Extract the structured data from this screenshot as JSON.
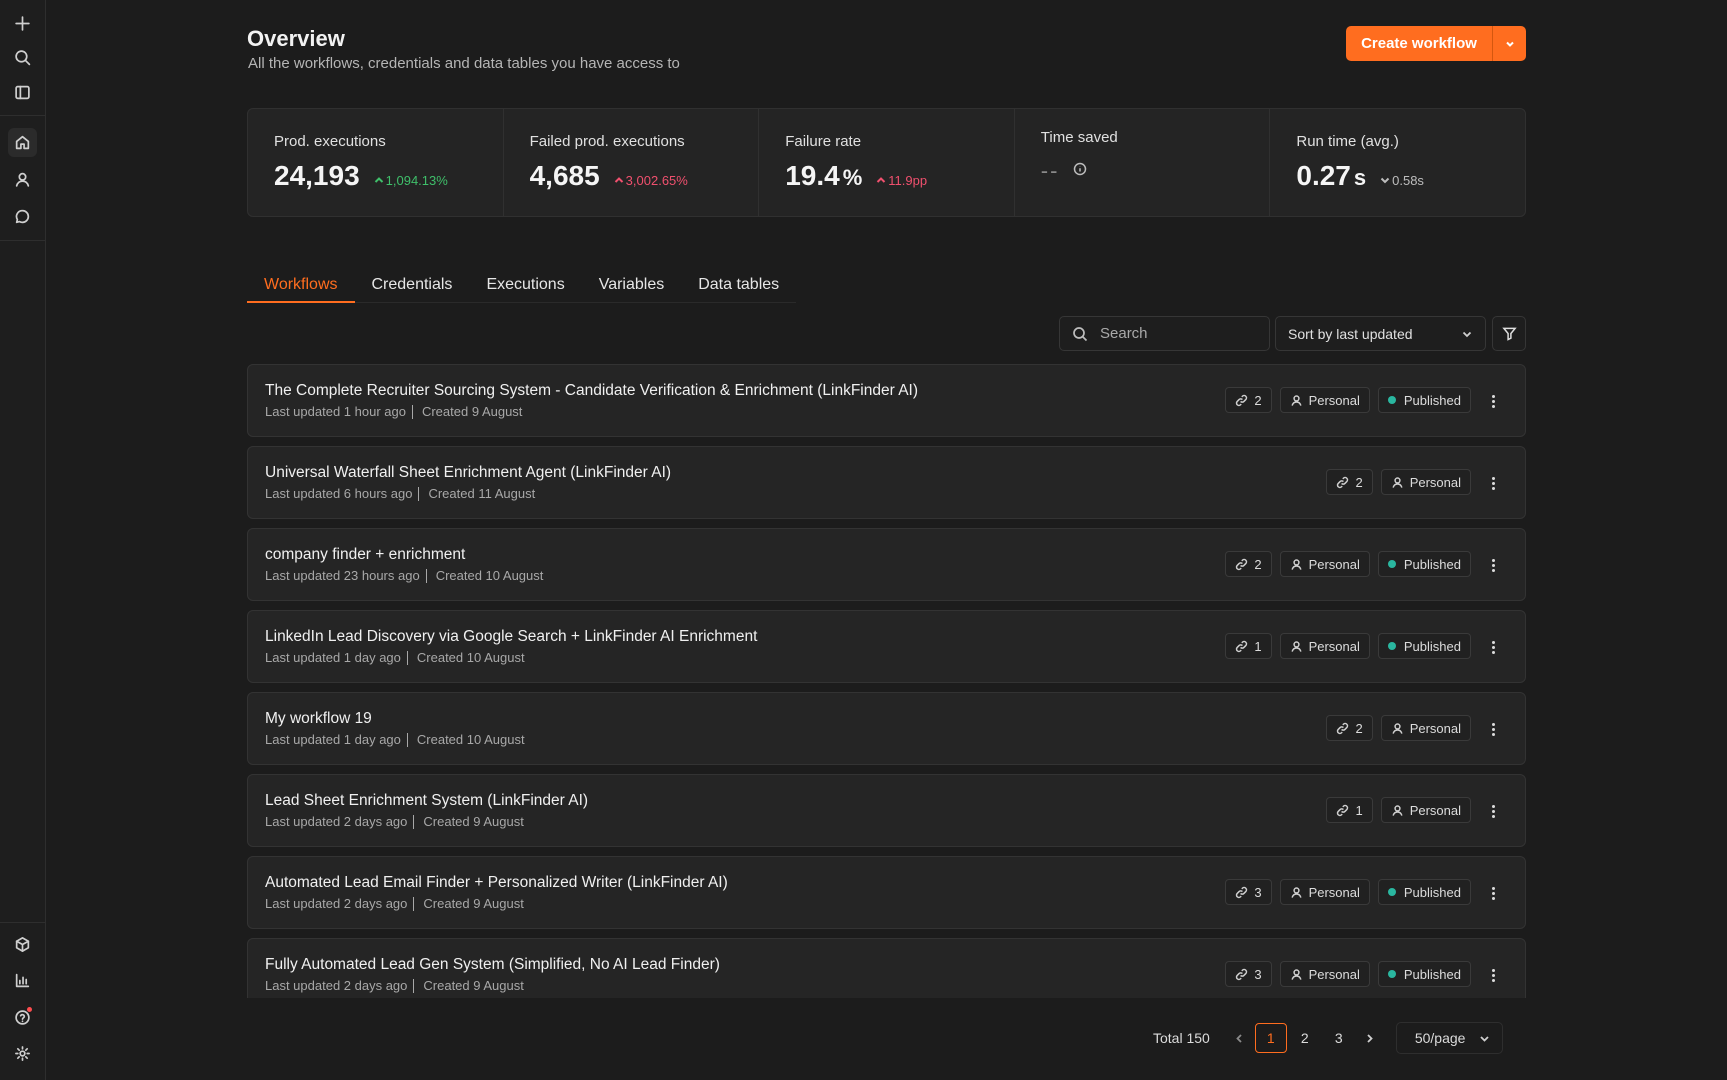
{
  "header": {
    "title": "Overview",
    "subtitle": "All the workflows, credentials and data tables you have access to",
    "create_label": "Create workflow"
  },
  "stats": [
    {
      "label": "Prod. executions",
      "value": "24,193",
      "unit": "",
      "delta": "1,094.13%",
      "trend": "up-good"
    },
    {
      "label": "Failed prod. executions",
      "value": "4,685",
      "unit": "",
      "delta": "3,002.65%",
      "trend": "up-bad"
    },
    {
      "label": "Failure rate",
      "value": "19.4",
      "unit": "%",
      "delta": "11.9pp",
      "trend": "up-bad"
    },
    {
      "label": "Time saved",
      "value": "--",
      "unit": "",
      "delta": "",
      "trend": "none"
    },
    {
      "label": "Run time (avg.)",
      "value": "0.27",
      "unit": "s",
      "delta": "0.58s",
      "trend": "down-neutral"
    }
  ],
  "tabs": [
    "Workflows",
    "Credentials",
    "Executions",
    "Variables",
    "Data tables"
  ],
  "toolbar": {
    "search_placeholder": "Search",
    "sort_label": "Sort by last updated"
  },
  "workflows": [
    {
      "title": "The Complete Recruiter Sourcing System - Candidate Verification & Enrichment (LinkFinder AI)",
      "updated": "Last updated 1 hour ago",
      "created": "Created 9 August",
      "links": "2",
      "owner": "Personal",
      "status": "Published"
    },
    {
      "title": "Universal Waterfall Sheet Enrichment Agent (LinkFinder AI)",
      "updated": "Last updated 6 hours ago",
      "created": "Created 11 August",
      "links": "2",
      "owner": "Personal",
      "status": ""
    },
    {
      "title": "company finder + enrichment",
      "updated": "Last updated 23 hours ago",
      "created": "Created 10 August",
      "links": "2",
      "owner": "Personal",
      "status": "Published"
    },
    {
      "title": "LinkedIn Lead Discovery via Google Search + LinkFinder AI Enrichment",
      "updated": "Last updated 1 day ago",
      "created": "Created 10 August",
      "links": "1",
      "owner": "Personal",
      "status": "Published"
    },
    {
      "title": "My workflow 19",
      "updated": "Last updated 1 day ago",
      "created": "Created 10 August",
      "links": "2",
      "owner": "Personal",
      "status": ""
    },
    {
      "title": "Lead Sheet Enrichment System (LinkFinder AI)",
      "updated": "Last updated 2 days ago",
      "created": "Created 9 August",
      "links": "1",
      "owner": "Personal",
      "status": ""
    },
    {
      "title": "Automated Lead Email Finder + Personalized Writer (LinkFinder AI)",
      "updated": "Last updated 2 days ago",
      "created": "Created 9 August",
      "links": "3",
      "owner": "Personal",
      "status": "Published"
    },
    {
      "title": "Fully Automated Lead Gen System (Simplified, No AI Lead Finder)",
      "updated": "Last updated 2 days ago",
      "created": "Created 9 August",
      "links": "3",
      "owner": "Personal",
      "status": "Published"
    }
  ],
  "pagination": {
    "total": "Total 150",
    "pages": [
      "1",
      "2",
      "3"
    ],
    "current": "1",
    "per_page": "50/page"
  },
  "colors": {
    "accent": "#ff6d1f",
    "published_dot": "#2ab7a0",
    "positive": "#3fbf6a",
    "negative": "#f0506e"
  }
}
